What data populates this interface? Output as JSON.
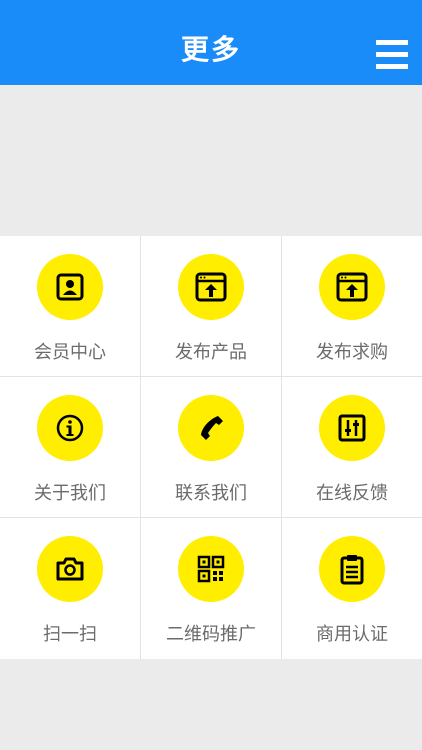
{
  "header": {
    "title": "更多",
    "background": "#1a8cfa",
    "menu_icon": "menu-icon"
  },
  "theme": {
    "icon_circle": "#ffee00",
    "icon_fg": "#000000",
    "label_color": "#6b6b6b"
  },
  "grid": {
    "items": [
      {
        "label": "会员中心",
        "icon": "member-icon",
        "name": "member-center"
      },
      {
        "label": "发布产品",
        "icon": "publish-upload-icon",
        "name": "publish-product"
      },
      {
        "label": "发布求购",
        "icon": "publish-upload-icon",
        "name": "publish-purchase"
      },
      {
        "label": "关于我们",
        "icon": "info-icon",
        "name": "about-us"
      },
      {
        "label": "联系我们",
        "icon": "phone-icon",
        "name": "contact-us"
      },
      {
        "label": "在线反馈",
        "icon": "sliders-icon",
        "name": "online-feedback"
      },
      {
        "label": "扫一扫",
        "icon": "camera-icon",
        "name": "scan"
      },
      {
        "label": "二维码推广",
        "icon": "qr-code-icon",
        "name": "qr-promotion"
      },
      {
        "label": "商用认证",
        "icon": "clipboard-icon",
        "name": "business-certification"
      }
    ]
  }
}
